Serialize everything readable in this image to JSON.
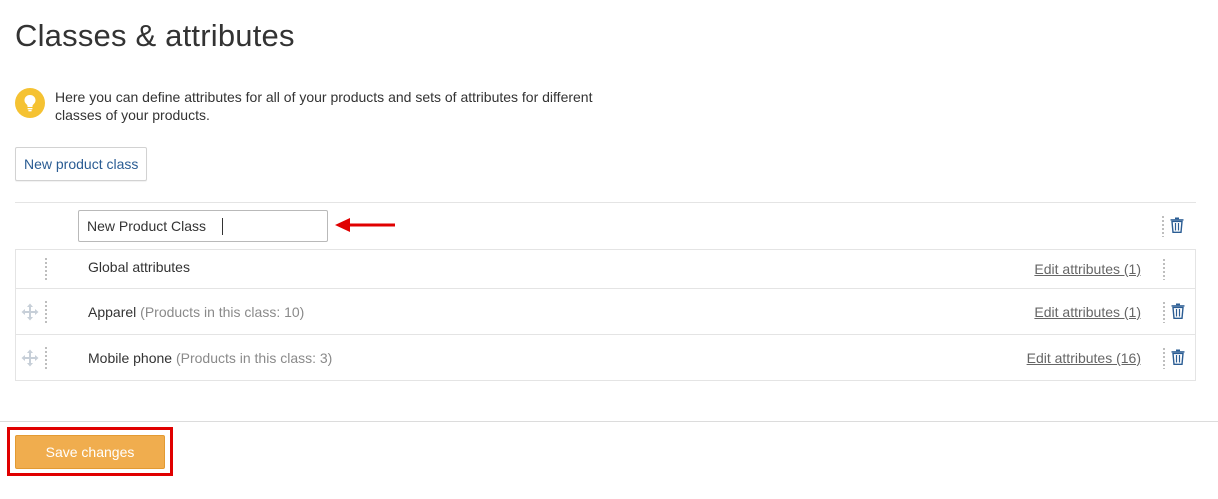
{
  "page": {
    "title": "Classes & attributes"
  },
  "info": {
    "text": "Here you can define attributes for all of your products and sets of attributes for different classes of your products."
  },
  "toolbar": {
    "new_class_label": "New product class"
  },
  "new_class_row": {
    "input_value": "New Product Class"
  },
  "classes": [
    {
      "name": "Global attributes",
      "count_text": "",
      "edit_label": "Edit attributes (1)"
    },
    {
      "name": "Apparel",
      "count_text": "(Products in this class: 10)",
      "edit_label": "Edit attributes (1)"
    },
    {
      "name": "Mobile phone",
      "count_text": "(Products in this class: 3)",
      "edit_label": "Edit attributes (16)"
    }
  ],
  "footer": {
    "save_label": "Save changes"
  },
  "colors": {
    "accent_button": "#f0ad4e",
    "link_blue": "#2a5c93",
    "annotation_red": "#e00000",
    "info_icon": "#f5c232"
  }
}
